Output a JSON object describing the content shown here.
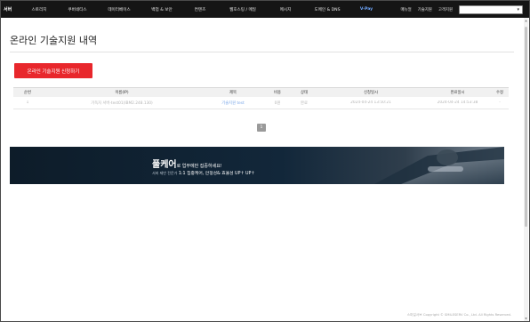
{
  "nav": {
    "logo": "서버",
    "items": [
      "스토리지",
      "쿠버네티스",
      "데이터베이스",
      "백업 & 보안",
      "컨텐츠",
      "웹호스팅 / 메일",
      "메시지",
      "도메인 & DNS",
      "V-Pay"
    ],
    "right_links": [
      "매뉴얼",
      "기술지원",
      "고객지원"
    ],
    "search_value": "",
    "search_caret_icon": "chevron-down-icon"
  },
  "page": {
    "title": "온라인 기술지원 내역",
    "apply_button": "온라인 기술지원 신청하기"
  },
  "table": {
    "headers": [
      "순번",
      "이름(IP)",
      "제목",
      "비용",
      "상태",
      "신청일시",
      "완료일시",
      "수정"
    ],
    "rows": [
      [
        "1",
        "가독자 서버-test01(lBM2.248.130)",
        "기술지원 test",
        "0원",
        "완료",
        "2024-04-24 13:50:21",
        "2024-04-24 14:53:38",
        "-"
      ]
    ]
  },
  "pagination": {
    "current": "1"
  },
  "banner": {
    "headline_big": "풀케어",
    "headline_small": "로 업무에만 집중하세요!",
    "sub_prefix": "서버 제반 전문가",
    "sub_text": "1:1 집중케어, 안정성& 효율성 UP↑ UP↑"
  },
  "footer": {
    "copyright": "스마일서브 Copyright © SMILESERV Co., Ltd. All Rights Reserved."
  },
  "colors": {
    "nav_bg": "#151515",
    "accent_red": "#e8272c",
    "vpay_blue": "#6fa8ff",
    "banner_bg": "#0f1f2d",
    "link_blue": "#7aa7e8"
  }
}
